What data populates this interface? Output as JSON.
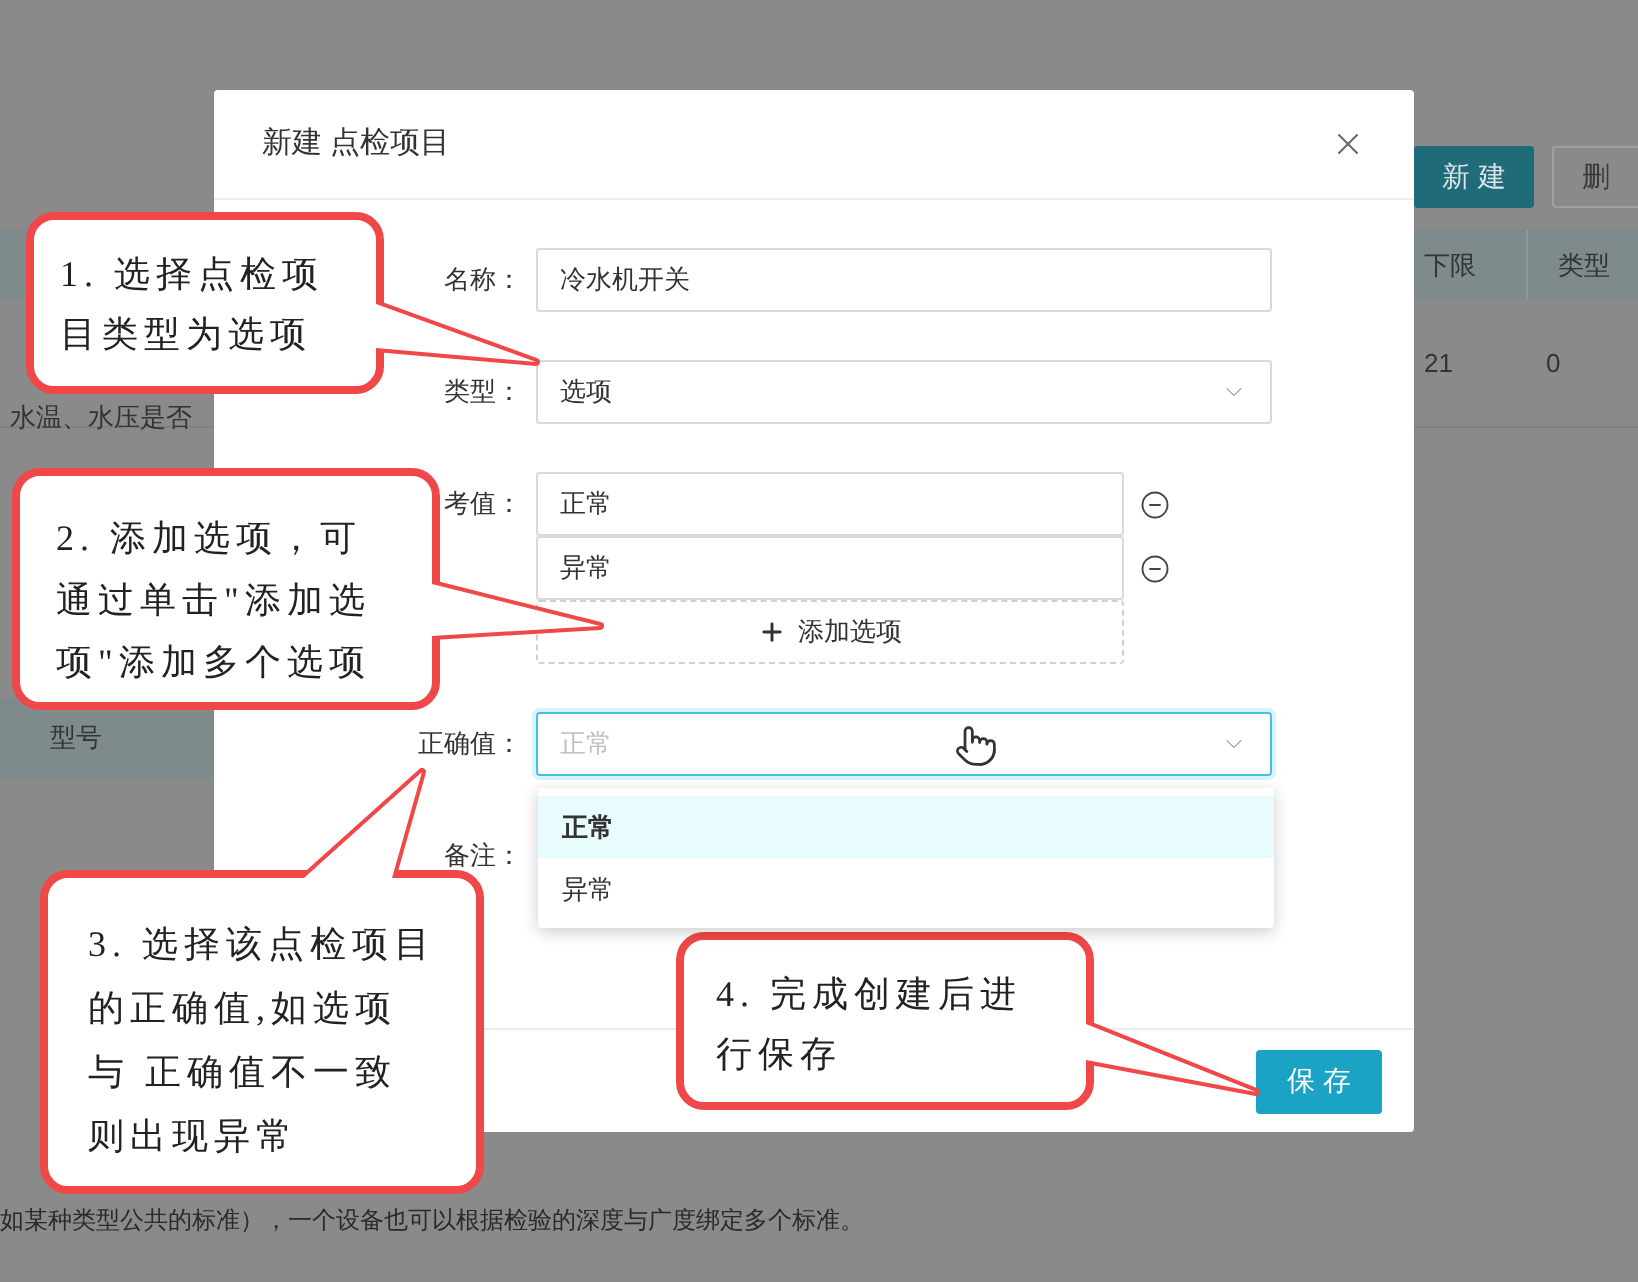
{
  "background_page": {
    "buttons": [
      {
        "label": "新 建",
        "kind": "primary"
      },
      {
        "label": "删",
        "kind": "outline"
      }
    ],
    "table": {
      "columns": [
        "下限",
        "类型"
      ],
      "rows": [
        [
          "21",
          "0"
        ]
      ]
    },
    "left_fragments": [
      "水温、水压是否",
      "型号"
    ],
    "footer_note": "如某种类型公共的标准），一个设备也可以根据检验的深度与广度绑定多个标准。"
  },
  "dialog": {
    "title": "新建 点检项目",
    "fields": [
      {
        "kind": "text",
        "label": "名称：",
        "value": "冷水机开关"
      },
      {
        "kind": "select",
        "label": "类型：",
        "value": "选项"
      },
      {
        "kind": "options",
        "label": "考值：",
        "options": [
          "正常",
          "异常"
        ],
        "add_label": "添加选项"
      },
      {
        "kind": "select_open",
        "label": "正确值：",
        "placeholder": "正常",
        "menu": [
          {
            "label": "正常",
            "selected": true
          },
          {
            "label": "异常",
            "selected": false
          }
        ]
      },
      {
        "kind": "note",
        "label": "备注："
      }
    ],
    "save_button": "保 存"
  },
  "callouts": [
    {
      "lines": [
        "1. 选择点检项",
        "目类型为选项"
      ]
    },
    {
      "lines": [
        "2. 添加选项，可",
        "通过单击\"添加选",
        "项\"添加多个选项"
      ]
    },
    {
      "lines": [
        "3. 选择该点检项目",
        "的正确值,如选项",
        "与 正确值不一致",
        "则出现异常"
      ]
    },
    {
      "lines": [
        "4. 完成创建后进",
        "行保存"
      ]
    }
  ]
}
